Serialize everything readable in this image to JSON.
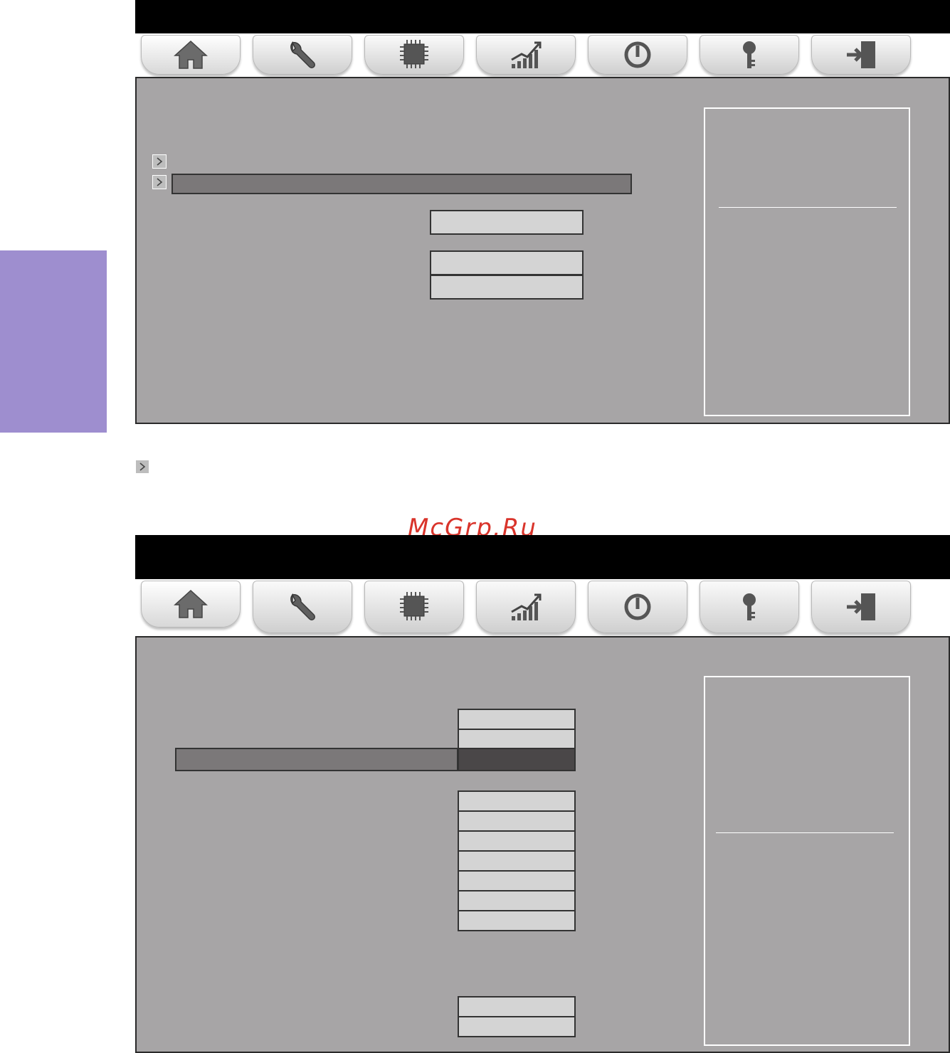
{
  "watermark": "McGrp.Ru",
  "colors": {
    "side_tab": "#9e8ecf",
    "panel": "#a7a5a6",
    "title_bar": "#000000",
    "highlight_row": "#7b7879",
    "value_box": "#d4d4d4",
    "selected_value": "#4a4748",
    "watermark": "#d9342b"
  },
  "tabs": [
    {
      "icon": "home-icon"
    },
    {
      "icon": "wrench-icon"
    },
    {
      "icon": "cpu-chip-icon"
    },
    {
      "icon": "chart-growth-icon"
    },
    {
      "icon": "power-cycle-icon"
    },
    {
      "icon": "key-icon"
    },
    {
      "icon": "exit-door-icon"
    }
  ],
  "screens": [
    {
      "active_tab": 0,
      "value_boxes": [
        "",
        "",
        ""
      ]
    },
    {
      "active_tab": 0,
      "value_boxes": [
        "",
        "",
        "",
        "",
        "",
        "",
        "",
        "",
        "",
        "",
        "",
        ""
      ],
      "selected_value_index": 2
    }
  ]
}
